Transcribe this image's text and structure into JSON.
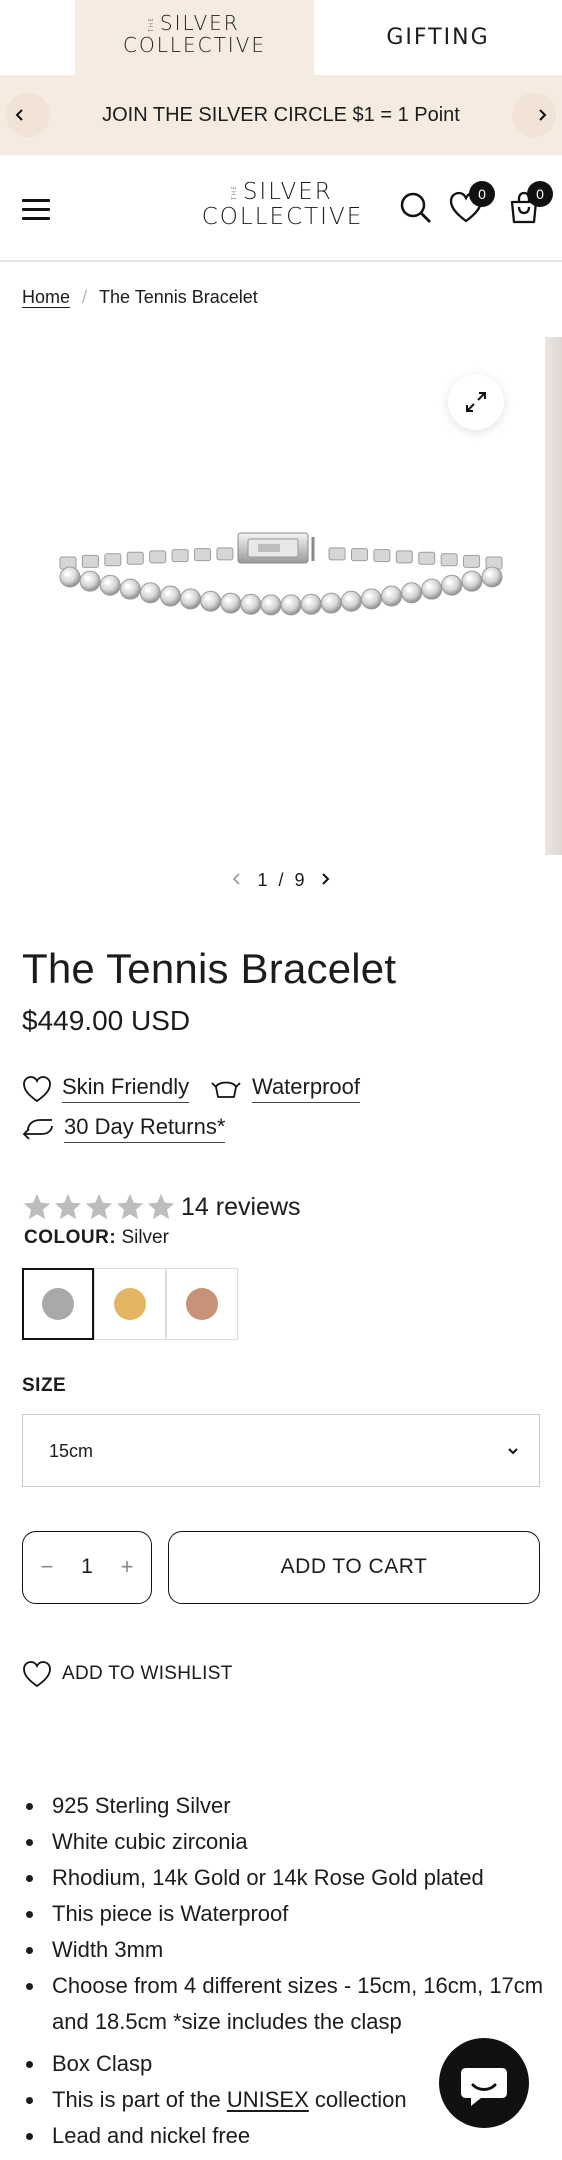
{
  "topnav": {
    "brand_the": "THE",
    "brand_line1": "SILVER",
    "brand_line2": "COLLECTIVE",
    "gifting_label": "GIFTING"
  },
  "announcement": {
    "text": "JOIN THE SILVER CIRCLE $1 = 1 Point"
  },
  "header": {
    "brand_the": "THE",
    "brand_line1": "SILVER",
    "brand_line2": "COLLECTIVE",
    "wishlist_count": "0",
    "cart_count": "0"
  },
  "breadcrumb": {
    "home": "Home",
    "separator": "/",
    "current": "The Tennis Bracelet"
  },
  "gallery": {
    "current": "1",
    "separator": "/",
    "total": "9"
  },
  "product": {
    "title": "The Tennis Bracelet",
    "price": "$449.00 USD",
    "features": [
      {
        "label": "Skin Friendly",
        "icon": "heart-icon"
      },
      {
        "label": "Waterproof",
        "icon": "basin-icon"
      },
      {
        "label": "30 Day Returns*",
        "icon": "return-arrow-icon"
      }
    ],
    "rating": 0,
    "reviews_label": "14 reviews",
    "colour_label": "COLOUR:",
    "colour_value": "Silver",
    "swatches": [
      {
        "name": "Silver",
        "color": "#a9a9a9"
      },
      {
        "name": "Gold",
        "color": "#e3b461"
      },
      {
        "name": "Rose Gold",
        "color": "#c69278"
      }
    ],
    "size_label": "SIZE",
    "size_value": "15cm",
    "quantity": "1",
    "add_to_cart": "ADD TO CART",
    "wishlist_label": "ADD TO WISHLIST"
  },
  "details": {
    "b1": "925 Sterling Silver",
    "b2": "White cubic zirconia",
    "b3": "Rhodium, 14k Gold or 14k Rose Gold plated",
    "b4": "This piece is Waterproof",
    "b5": "Width 3mm",
    "b6": "Choose from 4 different sizes - 15cm, 16cm, 17cm and 18.5cm *size includes the clasp",
    "b7": "Box Clasp",
    "b8_prefix": "This is part of the ",
    "b8_link": "UNISEX",
    "b8_suffix": " collection",
    "b9": "Lead and nickel free"
  },
  "colors": {
    "accent_bg": "#f6ebe0",
    "text": "#1c1c1c",
    "star_empty": "#bdbdbd"
  }
}
